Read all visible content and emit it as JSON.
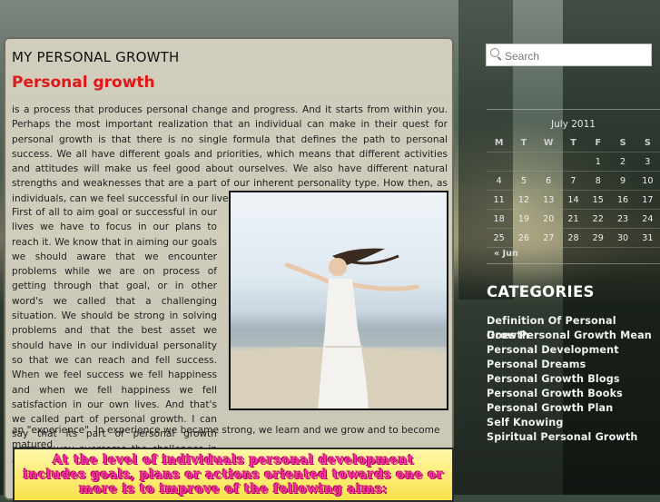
{
  "site": {
    "title": "MY PERSONAL GROWTH"
  },
  "post": {
    "title": "Personal growth",
    "paragraph1": "is a process that produces personal change and progress. And it starts from within you. Perhaps the most important realization that an individual can make in their quest for personal growth is that there is no single formula that defines the path to personal success. We all have different goals and priorities, which means that different activities and attitudes will make us feel good about ourselves. We also have different natural strengths and weaknesses that are a part of our inherent personality type. How then, as individuals, can we feel successful in our lives?",
    "paragraph2": "First of all to aim goal or successful in our lives we have to focus in our plans to reach it. We know that in aiming our goals we should aware that we encounter problems while we are on process of getting through that goal, or in other word's we called that a challenging situation. We should be strong in solving problems and that the best asset we should have in our individual personality so that we can reach and fell success. When we feel success we fell happiness and when we fell happiness we fell satisfaction in our own lives. And that's we called part of personal growth. I can say that its part of personal growth because you overcome the challenges in your life and we called it also",
    "paragraph3": "an \"experience\". In experience we became strong, we learn and we grow and to become matured.",
    "banner": "At the level of individuals personal development includes goals, plans or actions oriented towards one or more is to improve of the following aims:"
  },
  "sidebar": {
    "search": {
      "placeholder": "Search"
    },
    "calendar": {
      "caption": "July 2011",
      "weekdays": [
        "M",
        "T",
        "W",
        "T",
        "F",
        "S",
        "S"
      ],
      "weeks": [
        [
          "",
          "",
          "",
          "",
          "1",
          "2",
          "3"
        ],
        [
          "4",
          "5",
          "6",
          "7",
          "8",
          "9",
          "10"
        ],
        [
          "11",
          "12",
          "13",
          "14",
          "15",
          "16",
          "17"
        ],
        [
          "18",
          "19",
          "20",
          "21",
          "22",
          "23",
          "24"
        ],
        [
          "25",
          "26",
          "27",
          "28",
          "29",
          "30",
          "31"
        ]
      ],
      "prev_link": "« Jun"
    },
    "categories": {
      "title": "CATEGORIES",
      "items": [
        "Definition Of Personal Growth",
        "Does Personal Growth Mean",
        "Personal Development",
        "Personal Dreams",
        "Personal Growth Blogs",
        "Personal Growth Books",
        "Personal Growth Plan",
        "Self Knowing",
        "Spiritual Personal Growth"
      ]
    }
  },
  "colors": {
    "post_title": "#e01818",
    "banner_text": "#ff2fa0",
    "banner_bg": "#f9e24a"
  }
}
